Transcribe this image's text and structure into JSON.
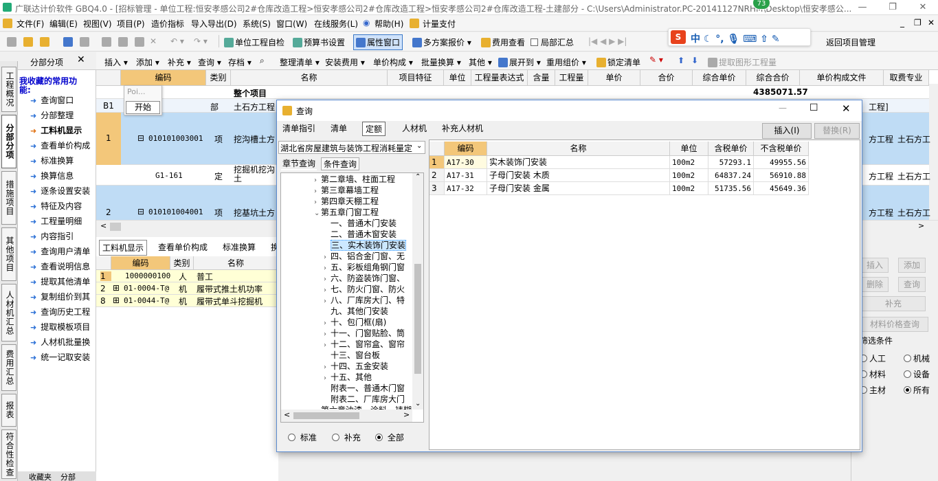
{
  "titlebar": {
    "title": "广联达计价软件 GBQ4.0 - [招标管理 - 单位工程:恒安孝感公司2#仓库改造工程>恒安孝感公司2#仓库改造工程>恒安孝感公司2#仓库改造工程-土建部分 - C:\\Users\\Administrator.PC-20141127NRHM\\Desktop\\恒安孝感公...",
    "badge": "73",
    "min": "—",
    "max": "❐",
    "close": "✕"
  },
  "menu": [
    "文件(F)",
    "编辑(E)",
    "视图(V)",
    "项目(P)",
    "造价指标",
    "导入导出(D)",
    "系统(S)",
    "窗口(W)",
    "在线服务(L)",
    "帮助(H)",
    "计量支付"
  ],
  "toolbar2": {
    "self_check": "单位工程自检",
    "budget_settings": "预算书设置",
    "property_window": "属性窗口",
    "multi_quote": "多方案报价",
    "fee_view": "费用查看",
    "local_summary": "局部汇总",
    "back": "返回项目管理"
  },
  "toolbar3": [
    "插入",
    "添加",
    "补充",
    "查询",
    "存档",
    "整理清单",
    "安装费用",
    "单价构成",
    "批量换算",
    "其他",
    "展开到",
    "重用组价",
    "锁定清单",
    "提取图形工程量"
  ],
  "leftpanel": {
    "header": "分部分项",
    "close": "✕",
    "fav_title": "我收藏的常用功能:",
    "items": [
      "查询窗口",
      "分部整理",
      "工料机显示",
      "查看单价构成",
      "标准换算",
      "换算信息",
      "逐条设置安装",
      "特征及内容",
      "工程量明细",
      "内容指引",
      "查询用户清单",
      "查看说明信息",
      "提取其他清单",
      "复制组价到其",
      "查询历史工程",
      "提取模板项目",
      "人材机批量换",
      "统一记取安装"
    ],
    "bottom": "收藏夹",
    "bottom2": "分部"
  },
  "vtabs": [
    "工程概况",
    "分部分项",
    "措施项目",
    "其他项目",
    "人材机汇总",
    "费用汇总",
    "报表",
    "符合性检查"
  ],
  "grid": {
    "headers": [
      "编码",
      "类别",
      "名称",
      "项目特征",
      "单位",
      "工程量表达式",
      "含量",
      "工程量",
      "单价",
      "合价",
      "综合单价",
      "综合合价",
      "单价构成文件",
      "取费专业"
    ],
    "whole": "整个项目",
    "total": "4385071.57",
    "popup": "Poi...",
    "popup_btn": "开始",
    "rows": [
      {
        "no": "B1",
        "code": "",
        "type": "部",
        "name": "土石方工程",
        "file": "工程]",
        "fee": ""
      },
      {
        "no": "1",
        "code": "010101003001",
        "type": "项",
        "name": "挖沟槽土方",
        "file": "方工程",
        "fee": "土石方工"
      },
      {
        "no": "",
        "code": "G1-161",
        "type": "定",
        "name": "挖掘机挖沟土",
        "file": "方工程",
        "fee": "土石方工"
      },
      {
        "no": "2",
        "code": "010101004001",
        "type": "项",
        "name": "挖基坑土方",
        "file": "方工程",
        "fee": "土石方工"
      }
    ]
  },
  "bottom": {
    "tabs": [
      "工料机显示",
      "查看单价构成",
      "标准换算",
      "换"
    ],
    "headers": [
      "编码",
      "类别",
      "名称"
    ],
    "rows": [
      {
        "no": "1",
        "code": "1000000100",
        "type": "人",
        "name": "普工"
      },
      {
        "no": "2",
        "code": "01-0004-T@",
        "type": "机",
        "name": "履带式推土机功率"
      },
      {
        "no": "8",
        "code": "01-0044-T@",
        "type": "机",
        "name": "履带式单斗挖掘机"
      }
    ]
  },
  "right": {
    "buttons": [
      "插入",
      "添加",
      "删除",
      "查询",
      "补充",
      "材料价格查询"
    ],
    "filter_title": "筛选条件",
    "filters": [
      "人工",
      "机械",
      "材料",
      "设备",
      "主材",
      "所有"
    ]
  },
  "dialog": {
    "title": "查询",
    "tabs": [
      "清单指引",
      "清单",
      "定额",
      "人材机",
      "补充人材机"
    ],
    "insert": "插入(I)",
    "replace": "替换(R)",
    "quota_lib": "湖北省房屋建筑与装饰工程消耗量定",
    "sub_tabs": [
      "章节查询",
      "条件查询"
    ],
    "tree": [
      "第二章墙、柱面工程",
      "第三章幕墙工程",
      "第四章天棚工程",
      "第五章门窗工程",
      "一、普通木门安装",
      "二、普通木窗安装",
      "三、实木装饰门安装",
      "四、铝合金门窗、无",
      "五、彩板组角钢门窗",
      "六、防盗装饰门窗、",
      "七、防火门窗、防火",
      "八、厂库房大门、特",
      "九、其他门安装",
      "十、包门框(扇)",
      "十一、门窗贴脸、筒",
      "十二、窗帘盒、窗帘",
      "十三、窗台板",
      "十四、五金安装",
      "十五、其他",
      "附表一、普通木门窗",
      "附表二、厂库房大门",
      "第六章油漆、涂料、裱糊"
    ],
    "radios": [
      "标准",
      "补充",
      "全部"
    ],
    "headers": [
      "编码",
      "名称",
      "单位",
      "含税单价",
      "不含税单价"
    ],
    "rows": [
      {
        "no": "1",
        "code": "A17-30",
        "name": "实木装饰门安装",
        "unit": "100m2",
        "p1": "57293.1",
        "p2": "49955.56"
      },
      {
        "no": "2",
        "code": "A17-31",
        "name": "子母门安装 木质",
        "unit": "100m2",
        "p1": "64837.24",
        "p2": "56910.88"
      },
      {
        "no": "3",
        "code": "A17-32",
        "name": "子母门安装 金属",
        "unit": "100m2",
        "p1": "51735.56",
        "p2": "45649.36"
      }
    ]
  }
}
